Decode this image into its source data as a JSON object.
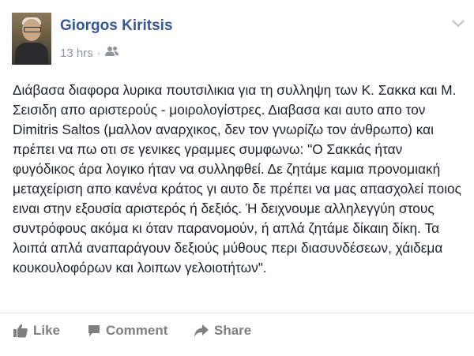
{
  "post": {
    "author": "Giorgos Kiritsis",
    "time": "13 hrs",
    "separator": "·",
    "privacy_icon": "friends-icon",
    "text": "Διάβασα διαφορα λυρικα πουτσιλικια για τη συλληψη των Κ. Σακκα και Μ. Σεισιδη απο αριστερούς - μοιρολογίστρες. Διαβασα και αυτο απο τον Dimitris Saltos (μαλλον αναρχικος, δεν τον γνωρίζω τον άνθρωπο) και πρέπει να πω οτι σε γενικες γραμμες συμφωνω: \"Ο Σακκάς ήταν φυγόδικος άρα λογικο ήταν να συλληφθεί. Δε ζητάμε καμια προνομιακή μεταχείριση απο κανένα κράτος γι αυτο δε πρέπει να μας απασχολεί ποιος ειναι στην εξουσία αριστερός ή δεξιός. Ή δειχνουμε αλληλεγγύη στους συντρόφους ακόμα κι όταν παρανομούν, ή απλά ζητάμε δίκαιη δίκη. Τα λοιπά απλά αναπαράγουν δεξιούς μύθους περι διασυνδέσεων, χάιδεμα κουκουλοφόρων και λοιπων γελοιοτήτων\"."
  },
  "actions": {
    "like": "Like",
    "comment": "Comment",
    "share": "Share"
  },
  "colors": {
    "name": "#365899",
    "meta": "#90949c",
    "action": "#7f7f7f",
    "text": "#1d2129"
  }
}
